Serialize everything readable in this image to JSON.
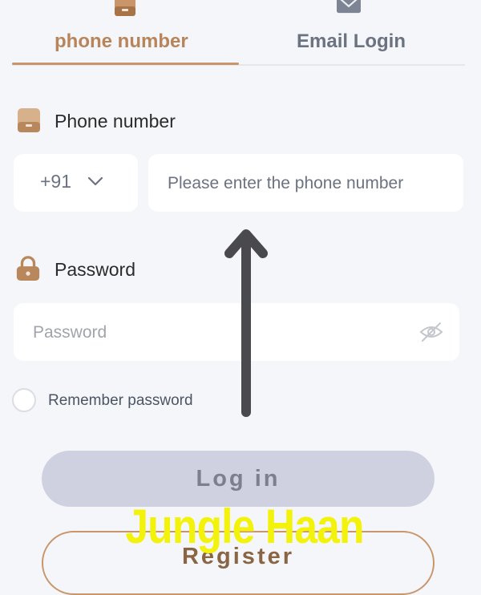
{
  "tabs": [
    {
      "label": "phone number",
      "icon": "phone-icon",
      "active": true
    },
    {
      "label": "Email Login",
      "icon": "mail-icon",
      "active": false
    }
  ],
  "phone_section": {
    "label": "Phone number",
    "icon": "phone-icon",
    "country_code": "+91",
    "placeholder": "Please enter the phone number"
  },
  "password_section": {
    "label": "Password",
    "icon": "lock-icon",
    "placeholder": "Password"
  },
  "remember": {
    "label": "Remember password",
    "checked": false
  },
  "buttons": {
    "login": "Log in",
    "register": "Register"
  },
  "watermark": "Jungle Haan",
  "colors": {
    "accent": "#c9956a",
    "active_tab_text": "#b8855a",
    "login_disabled_bg": "#cfd1e0",
    "watermark": "#f2f20a",
    "page_bg": "#f5f6fa"
  }
}
